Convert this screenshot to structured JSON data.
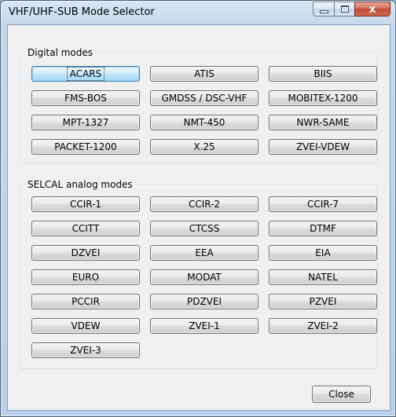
{
  "window": {
    "title": "VHF/UHF-SUB Mode Selector"
  },
  "caption_buttons": {
    "minimize_icon": "minimize-icon",
    "maximize_icon": "maximize-icon",
    "close_symbol": "x"
  },
  "digital": {
    "legend": "Digital modes",
    "buttons": [
      "ACARS",
      "ATIS",
      "BIIS",
      "FMS-BOS",
      "GMDSS / DSC-VHF",
      "MOBITEX-1200",
      "MPT-1327",
      "NMT-450",
      "NWR-SAME",
      "PACKET-1200",
      "X.25",
      "ZVEI-VDEW"
    ]
  },
  "selcal": {
    "legend": "SELCAL analog modes",
    "buttons": [
      "CCIR-1",
      "CCIR-2",
      "CCIR-7",
      "CCITT",
      "CTCSS",
      "DTMF",
      "DZVEI",
      "EEA",
      "EIA",
      "EURO",
      "MODAT",
      "NATEL",
      "PCCIR",
      "PDZVEI",
      "PZVEI",
      "VDEW",
      "ZVEI-1",
      "ZVEI-2",
      "ZVEI-3"
    ]
  },
  "footer": {
    "close_label": "Close"
  }
}
